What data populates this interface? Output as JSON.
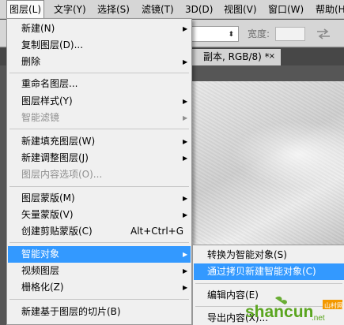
{
  "menubar": {
    "items": [
      {
        "label": "图层(L)"
      },
      {
        "label": "文字(Y)"
      },
      {
        "label": "选择(S)"
      },
      {
        "label": "滤镜(T)"
      },
      {
        "label": "3D(D)"
      },
      {
        "label": "视图(V)"
      },
      {
        "label": "窗口(W)"
      },
      {
        "label": "帮助(H)"
      }
    ]
  },
  "optionsbar": {
    "blend_value": "常",
    "width_label": "宽度:"
  },
  "document": {
    "tab_title": "副本, RGB/8) *",
    "close_glyph": "×"
  },
  "layer_menu": {
    "items": [
      {
        "label": "新建(N)",
        "has_submenu": true
      },
      {
        "label": "复制图层(D)..."
      },
      {
        "label": "删除",
        "has_submenu": true
      },
      {
        "label": "重命名图层..."
      },
      {
        "label": "图层样式(Y)",
        "has_submenu": true
      },
      {
        "label": "智能滤镜",
        "has_submenu": true,
        "disabled": true
      },
      {
        "label": "新建填充图层(W)",
        "has_submenu": true
      },
      {
        "label": "新建调整图层(J)",
        "has_submenu": true
      },
      {
        "label": "图层内容选项(O)...",
        "disabled": true
      },
      {
        "label": "图层蒙版(M)",
        "has_submenu": true
      },
      {
        "label": "矢量蒙版(V)",
        "has_submenu": true
      },
      {
        "label": "创建剪贴蒙版(C)",
        "shortcut": "Alt+Ctrl+G"
      },
      {
        "label": "智能对象",
        "has_submenu": true,
        "highlighted": true
      },
      {
        "label": "视频图层",
        "has_submenu": true
      },
      {
        "label": "栅格化(Z)",
        "has_submenu": true
      },
      {
        "label": "新建基于图层的切片(B)"
      }
    ]
  },
  "smart_object_submenu": {
    "items": [
      {
        "label": "转换为智能对象(S)"
      },
      {
        "label": "通过拷贝新建智能对象(C)",
        "highlighted": true
      },
      {
        "label": "编辑内容(E)"
      },
      {
        "label": "导出内容(X)..."
      }
    ]
  },
  "watermark": {
    "text": "shancun",
    "suffix": ".net",
    "badge": "山村网"
  },
  "colors": {
    "highlight": "#3399ff",
    "menu_bg": "#f0f0f0",
    "disabled_text": "#8f8f8f",
    "watermark_green": "#5aa51f",
    "watermark_orange": "#f39800"
  },
  "icons": {
    "submenu_arrow": "▶",
    "dropdown_chevron": "⬍"
  }
}
